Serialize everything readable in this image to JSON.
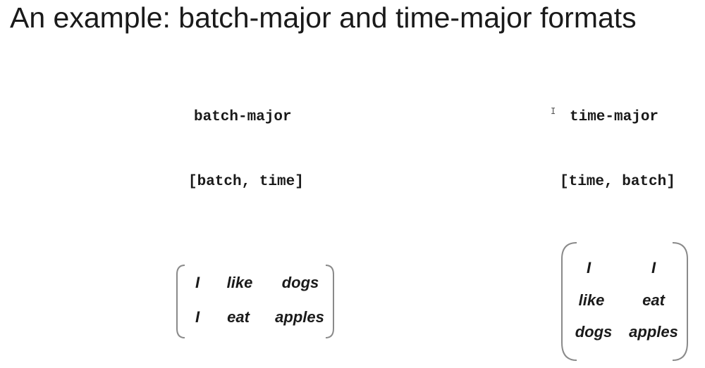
{
  "title": "An example: batch-major and time-major formats",
  "batch_major": {
    "label": "batch-major",
    "shape": "[batch, time]",
    "matrix": [
      [
        "I",
        "like",
        "dogs"
      ],
      [
        "I",
        "eat",
        "apples"
      ]
    ]
  },
  "time_major": {
    "label": "time-major",
    "shape": "[time, batch]",
    "matrix": [
      [
        "I",
        "I"
      ],
      [
        "like",
        "eat"
      ],
      [
        "dogs",
        "apples"
      ]
    ]
  },
  "icons": {
    "cursor": "text-cursor-icon"
  },
  "colors": {
    "text": "#1a1a1a",
    "bracket": "#8a8a8a"
  }
}
